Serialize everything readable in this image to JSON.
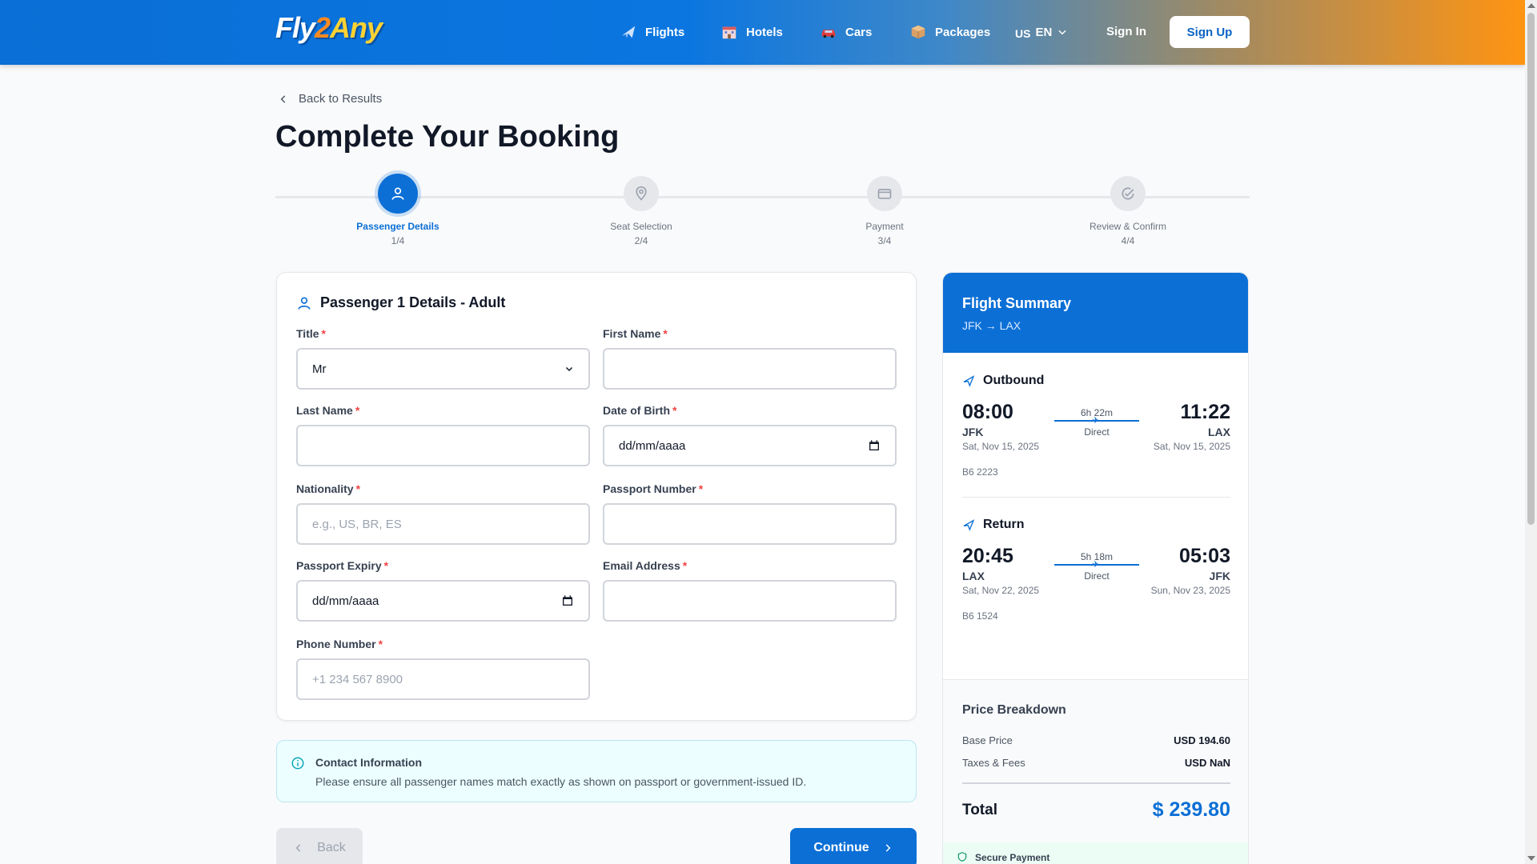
{
  "header": {
    "logo": {
      "part1": "Fly",
      "part2": "2",
      "part3": "Any"
    },
    "nav": [
      {
        "label": "Flights",
        "icon": "plane-icon"
      },
      {
        "label": "Hotels",
        "icon": "hotel-icon"
      },
      {
        "label": "Cars",
        "icon": "car-icon"
      },
      {
        "label": "Packages",
        "icon": "package-icon"
      }
    ],
    "language": {
      "flag": "US",
      "code": "EN"
    },
    "sign_in": "Sign In",
    "sign_up": "Sign Up"
  },
  "back_link": "Back to Results",
  "page_title": "Complete Your Booking",
  "stepper": [
    {
      "label": "Passenger Details",
      "count": "1/4",
      "icon": "user-icon",
      "active": true
    },
    {
      "label": "Seat Selection",
      "count": "2/4",
      "icon": "map-pin-icon",
      "active": false
    },
    {
      "label": "Payment",
      "count": "3/4",
      "icon": "credit-card-icon",
      "active": false
    },
    {
      "label": "Review & Confirm",
      "count": "4/4",
      "icon": "check-circle-icon",
      "active": false
    }
  ],
  "form": {
    "title": "Passenger 1 Details - Adult",
    "required_mark": "*",
    "fields": {
      "title": {
        "label": "Title",
        "value": "Mr"
      },
      "first_name": {
        "label": "First Name",
        "value": ""
      },
      "last_name": {
        "label": "Last Name",
        "value": ""
      },
      "dob": {
        "label": "Date of Birth",
        "value": "dd/mm/aaaa"
      },
      "nationality": {
        "label": "Nationality",
        "placeholder": "e.g., US, BR, ES"
      },
      "passport_number": {
        "label": "Passport Number",
        "value": ""
      },
      "passport_expiry": {
        "label": "Passport Expiry",
        "value": "dd/mm/aaaa"
      },
      "email": {
        "label": "Email Address",
        "value": ""
      },
      "phone": {
        "label": "Phone Number",
        "placeholder": "+1 234 567 8900"
      }
    }
  },
  "contact": {
    "title": "Contact Information",
    "body": "Please ensure all passenger names match exactly as shown on passport or government-issued ID."
  },
  "buttons": {
    "back": "Back",
    "continue": "Continue"
  },
  "summary": {
    "title": "Flight Summary",
    "route": "JFK → LAX",
    "outbound": {
      "title": "Outbound",
      "dep_time": "08:00",
      "dep_code": "JFK",
      "dep_date": "Sat, Nov 15, 2025",
      "arr_time": "11:22",
      "arr_code": "LAX",
      "arr_date": "Sat, Nov 15, 2025",
      "duration": "6h 22m",
      "stops": "Direct",
      "flight_no": "B6 2223"
    },
    "return": {
      "title": "Return",
      "dep_time": "20:45",
      "dep_code": "LAX",
      "dep_date": "Sat, Nov 22, 2025",
      "arr_time": "05:03",
      "arr_code": "JFK",
      "arr_date": "Sun, Nov 23, 2025",
      "duration": "5h 18m",
      "stops": "Direct",
      "flight_no": "B6 1524"
    },
    "price": {
      "title": "Price Breakdown",
      "base_label": "Base Price",
      "base_value": "USD 194.60",
      "taxes_label": "Taxes & Fees",
      "taxes_value": "USD NaN",
      "total_label": "Total",
      "total_value": "$ 239.80"
    },
    "secure": "Secure Payment"
  },
  "colors": {
    "primary": "#0b6fd6",
    "accent_orange": "#ff9412",
    "required": "#ef4444"
  }
}
